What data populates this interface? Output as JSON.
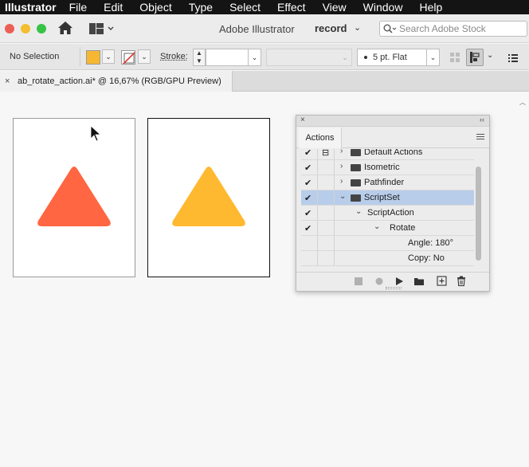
{
  "menubar": {
    "app": "Illustrator",
    "items": [
      "File",
      "Edit",
      "Object",
      "Type",
      "Select",
      "Effect",
      "View",
      "Window",
      "Help"
    ]
  },
  "appbar": {
    "app_name": "Adobe Illustrator",
    "workspace": "record",
    "search_placeholder": "Search Adobe Stock"
  },
  "control_bar": {
    "selection": "No Selection",
    "fill_color": "#f7b730",
    "stroke_label": "Stroke:",
    "stroke_profile": "5 pt. Flat"
  },
  "document_tab": {
    "close": "×",
    "title": "ab_rotate_action.ai* @ 16,67% (RGB/GPU Preview)"
  },
  "artboards": [
    {
      "triangle_color": "#ff6641"
    },
    {
      "triangle_color": "#ffb930"
    }
  ],
  "actions_panel": {
    "close": "×",
    "collapse": "‹‹",
    "tab": "Actions",
    "rows": [
      {
        "label": "Default Actions",
        "check": "✔",
        "toggle": "⊟",
        "arrow": "›",
        "folder": true
      },
      {
        "label": "Isometric",
        "check": "✔",
        "arrow": "›",
        "folder": true
      },
      {
        "label": "Pathfinder",
        "check": "✔",
        "arrow": "›",
        "folder": true
      },
      {
        "label": "ScriptSet",
        "check": "✔",
        "arrow": "⌄",
        "folder": true,
        "selected": true
      },
      {
        "label": "ScriptAction",
        "check": "✔",
        "arrow": "⌄"
      },
      {
        "label": "Rotate",
        "check": "✔",
        "arrow": "⌄"
      },
      {
        "label": "Angle: 180°"
      },
      {
        "label": "Copy: No"
      }
    ]
  },
  "colors": {
    "menubar": "#141414",
    "selection": "#b8cdea",
    "triangle_1": "#ff6641",
    "triangle_2": "#ffb930"
  }
}
